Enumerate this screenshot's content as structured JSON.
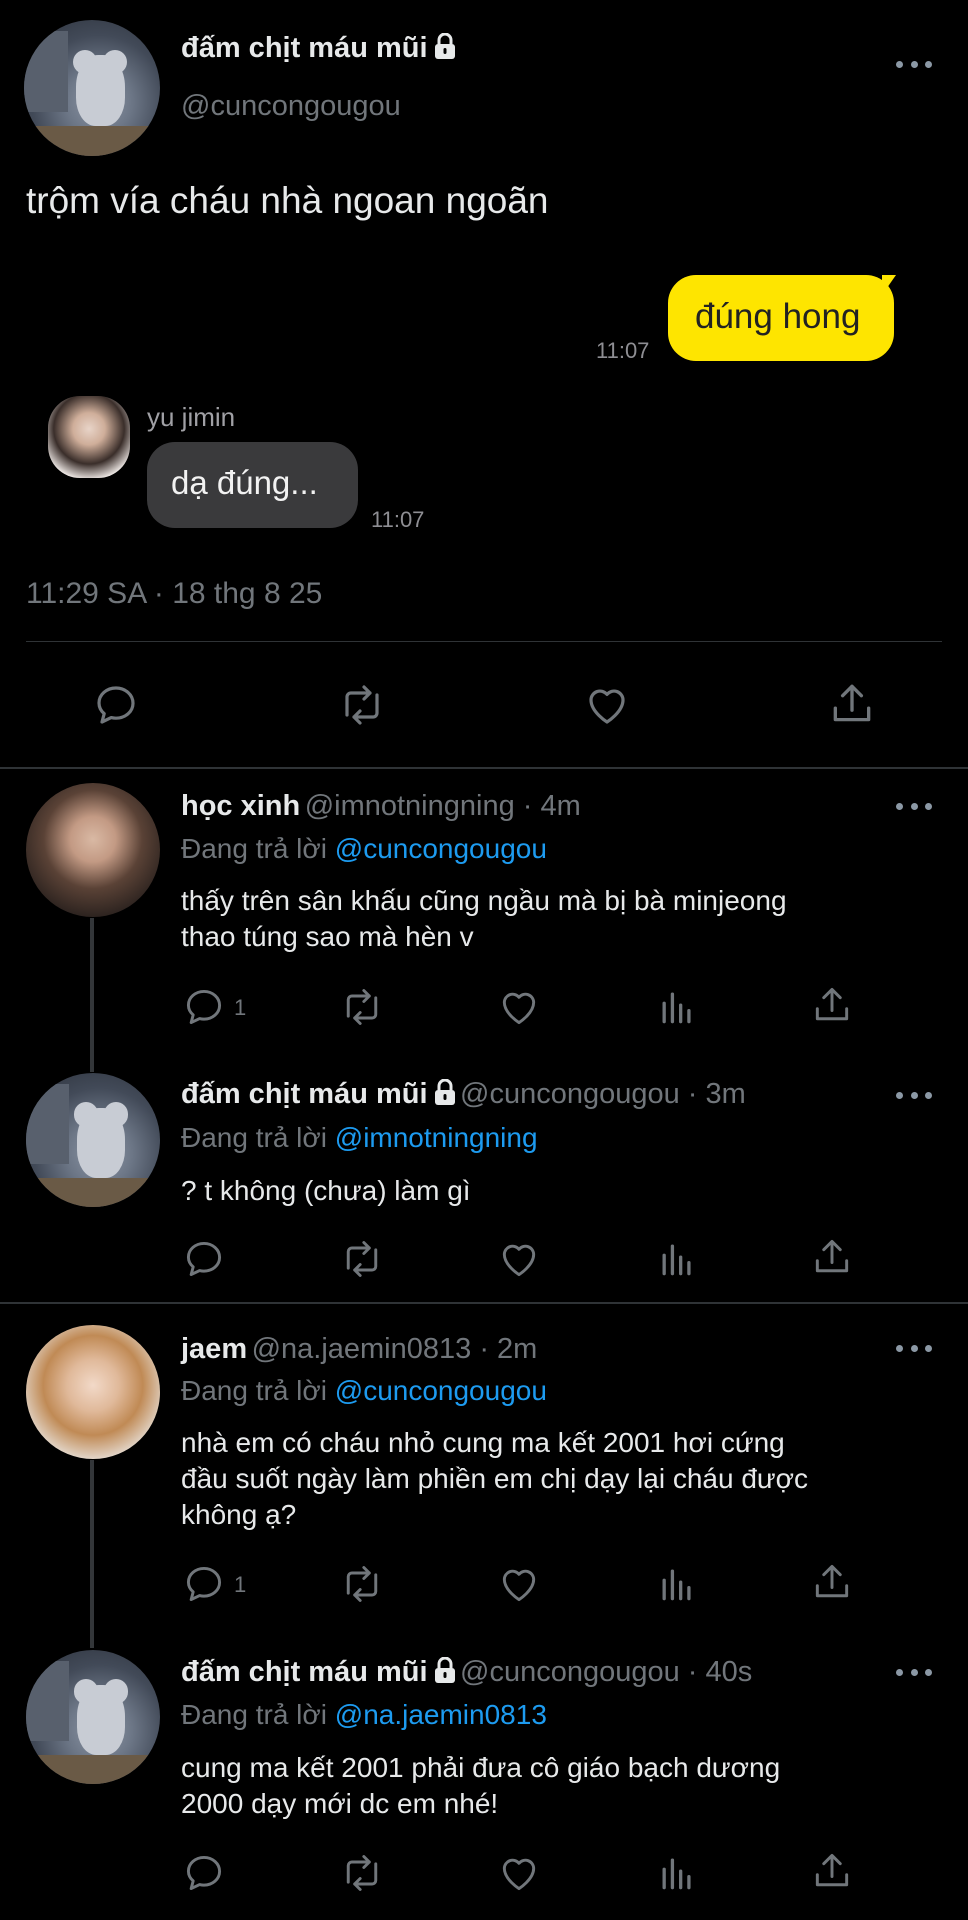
{
  "main_tweet": {
    "name": "đấm chịt máu mũi",
    "handle": "@cuncongougou",
    "text": "trộm vía cháu nhà ngoan ngoãn",
    "timestamp": "11:29 SA · 18 thg 8 25"
  },
  "chat": {
    "outgoing": {
      "text": "đúng hong",
      "time": "11:07",
      "color": "#fee500"
    },
    "incoming": {
      "sender": "yu jimin",
      "text": "dạ đúng...",
      "time": "11:07"
    }
  },
  "replies": [
    {
      "name": "học xinh",
      "handle_time": "@imnotningning · 4m",
      "replying_prefix": "Đang trả lời",
      "mention": "@cuncongougou",
      "lines": [
        "thấy trên sân khấu cũng ngầu mà bị bà minjeong",
        "thao túng sao mà hèn v"
      ],
      "reply_count": "1"
    },
    {
      "name": "đấm chịt máu mũi",
      "handle_time": "@cuncongougou · 3m",
      "replying_prefix": "Đang trả lời",
      "mention": "@imnotningning",
      "lines": [
        "? t không (chưa) làm gì"
      ],
      "reply_count": ""
    },
    {
      "name": "jaem",
      "handle_time": "@na.jaemin0813 · 2m",
      "replying_prefix": "Đang trả lời",
      "mention": "@cuncongougou",
      "lines": [
        "nhà em có cháu nhỏ cung ma kết 2001 hơi cứng",
        "đầu suốt ngày làm phiền em chị dạy lại cháu được",
        "không ạ?"
      ],
      "reply_count": "1"
    },
    {
      "name": "đấm chịt máu mũi",
      "handle_time": "@cuncongougou · 40s",
      "replying_prefix": "Đang trả lời",
      "mention": "@na.jaemin0813",
      "lines": [
        "cung ma kết 2001 phải đưa cô giáo bạch dương",
        "2000 dạy mới dc em nhé!"
      ],
      "reply_count": ""
    }
  ],
  "colors": {
    "background": "#000000",
    "accent": "#1d9bf0",
    "secondary_text": "#71767b",
    "chat_bubble_in": "#3a3a3c"
  }
}
